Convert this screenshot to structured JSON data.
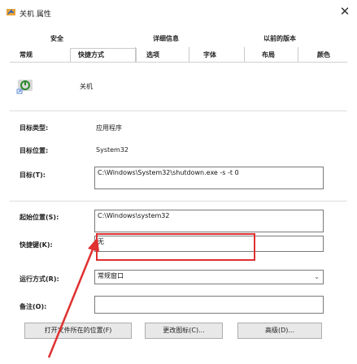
{
  "window": {
    "title": "关机 属性",
    "close_glyph": "✕"
  },
  "tabs_row1": [
    "安全",
    "详细信息",
    "以前的版本"
  ],
  "tabs_row2": [
    "常规",
    "快捷方式",
    "选项",
    "字体",
    "布局",
    "颜色"
  ],
  "shortcut": {
    "name": "关机"
  },
  "fields": {
    "target_type_label": "目标类型:",
    "target_type_value": "应用程序",
    "target_location_label": "目标位置:",
    "target_location_value": "System32",
    "target_label": "目标(T):",
    "target_value": "C:\\Windows\\System32\\shutdown.exe -s -t 0",
    "start_in_label": "起始位置(S):",
    "start_in_value": "C:\\Windows\\system32",
    "hotkey_label": "快捷键(K):",
    "hotkey_value": "无",
    "run_label": "运行方式(R):",
    "run_value": "常规窗口",
    "comment_label": "备注(O):",
    "comment_value": ""
  },
  "buttons": {
    "open_location": "打开文件所在的位置(F)",
    "change_icon": "更改图标(C)...",
    "advanced": "高级(D)..."
  },
  "colors": {
    "annotation_red": "#e03030"
  }
}
